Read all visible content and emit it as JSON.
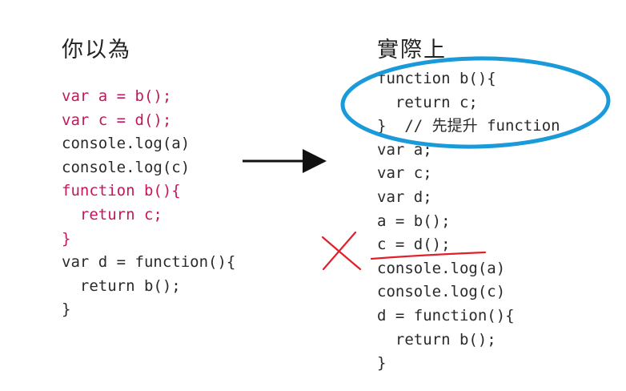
{
  "left": {
    "title": "你以為",
    "code_lines": [
      {
        "text": "var a = b();",
        "highlight": true
      },
      {
        "text": "var c = d();",
        "highlight": true
      },
      {
        "text": "console.log(a)",
        "highlight": false
      },
      {
        "text": "console.log(c)",
        "highlight": false
      },
      {
        "text": "function b(){",
        "highlight": true
      },
      {
        "text": "  return c;",
        "highlight": true
      },
      {
        "text": "}",
        "highlight": true
      },
      {
        "text": "var d = function(){",
        "highlight": false
      },
      {
        "text": "  return b();",
        "highlight": false
      },
      {
        "text": "}",
        "highlight": false
      }
    ]
  },
  "right": {
    "title": "實際上",
    "code_lines": [
      {
        "text": "function b(){"
      },
      {
        "text": "  return c;"
      },
      {
        "text": "}  // 先提升 function"
      },
      {
        "text": "var a;"
      },
      {
        "text": "var c;"
      },
      {
        "text": "var d;"
      },
      {
        "text": "a = b();"
      },
      {
        "text": "c = d();"
      },
      {
        "text": "console.log(a)"
      },
      {
        "text": "console.log(c)"
      },
      {
        "text": "d = function(){"
      },
      {
        "text": "  return b();"
      },
      {
        "text": "}"
      }
    ]
  },
  "colors": {
    "highlight": "#c2185b",
    "text": "#2a2a2a",
    "circle": "#1a9ad9",
    "annotation": "#e0202a",
    "arrow": "#111111"
  },
  "annotations": {
    "ellipse_icon": "blue-ellipse",
    "arrow_icon": "right-arrow",
    "cross_icon": "red-x-mark",
    "underline_icon": "red-underline"
  }
}
